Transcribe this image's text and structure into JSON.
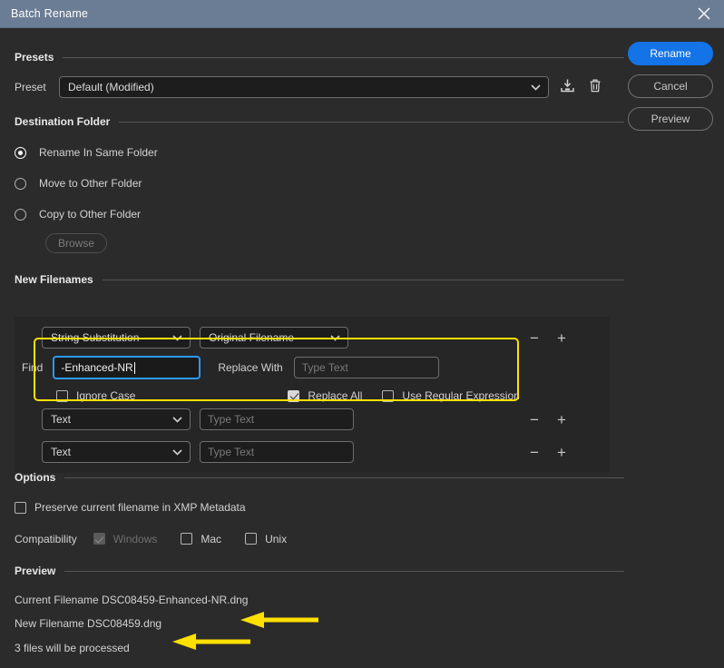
{
  "window": {
    "title": "Batch Rename",
    "close_icon": "close-icon"
  },
  "actions": {
    "rename_label": "Rename",
    "cancel_label": "Cancel",
    "preview_label": "Preview"
  },
  "presets": {
    "section_title": "Presets",
    "preset_label": "Preset",
    "preset_value": "Default (Modified)",
    "save_icon": "save-preset-icon",
    "delete_icon": "trash-icon"
  },
  "destination": {
    "section_title": "Destination Folder",
    "options": [
      {
        "label": "Rename In Same Folder",
        "selected": true
      },
      {
        "label": "Move to Other Folder",
        "selected": false
      },
      {
        "label": "Copy to Other Folder",
        "selected": false
      }
    ],
    "browse_label": "Browse"
  },
  "new_filenames": {
    "section_title": "New Filenames",
    "rows": [
      {
        "type_value": "String Substitution",
        "source_value": "Original Filename",
        "find_label": "Find",
        "find_value": "-Enhanced-NR",
        "replace_label": "Replace With",
        "replace_placeholder": "Type Text",
        "replace_value": "",
        "ignore_case_label": "Ignore Case",
        "ignore_case_checked": false,
        "replace_all_label": "Replace All",
        "replace_all_checked": true,
        "regex_label": "Use Regular Expression",
        "regex_checked": false,
        "remove_icon": "minus-icon",
        "add_icon": "plus-icon",
        "highlighted": true
      },
      {
        "type_value": "Text",
        "text_placeholder": "Type Text",
        "text_value": "",
        "remove_icon": "minus-icon",
        "add_icon": "plus-icon",
        "highlighted": false
      },
      {
        "type_value": "Text",
        "text_placeholder": "Type Text",
        "text_value": "",
        "remove_icon": "minus-icon",
        "add_icon": "plus-icon",
        "highlighted": false
      }
    ]
  },
  "options": {
    "section_title": "Options",
    "preserve_label": "Preserve current filename in XMP Metadata",
    "preserve_checked": false,
    "compatibility_label": "Compatibility",
    "compatibility": [
      {
        "label": "Windows",
        "checked": true,
        "disabled": true
      },
      {
        "label": "Mac",
        "checked": false,
        "disabled": false
      },
      {
        "label": "Unix",
        "checked": false,
        "disabled": false
      }
    ]
  },
  "preview": {
    "section_title": "Preview",
    "current_label": "Current Filename",
    "current_value": "DSC08459-Enhanced-NR.dng",
    "new_label": "New Filename",
    "new_value": "DSC08459.dng",
    "status": "3 files will be processed"
  },
  "colors": {
    "titlebar": "#6b7d95",
    "accent_primary": "#1473e6",
    "highlight": "#ffe000",
    "focus": "#2b9af3",
    "background": "#2b2b2b"
  }
}
